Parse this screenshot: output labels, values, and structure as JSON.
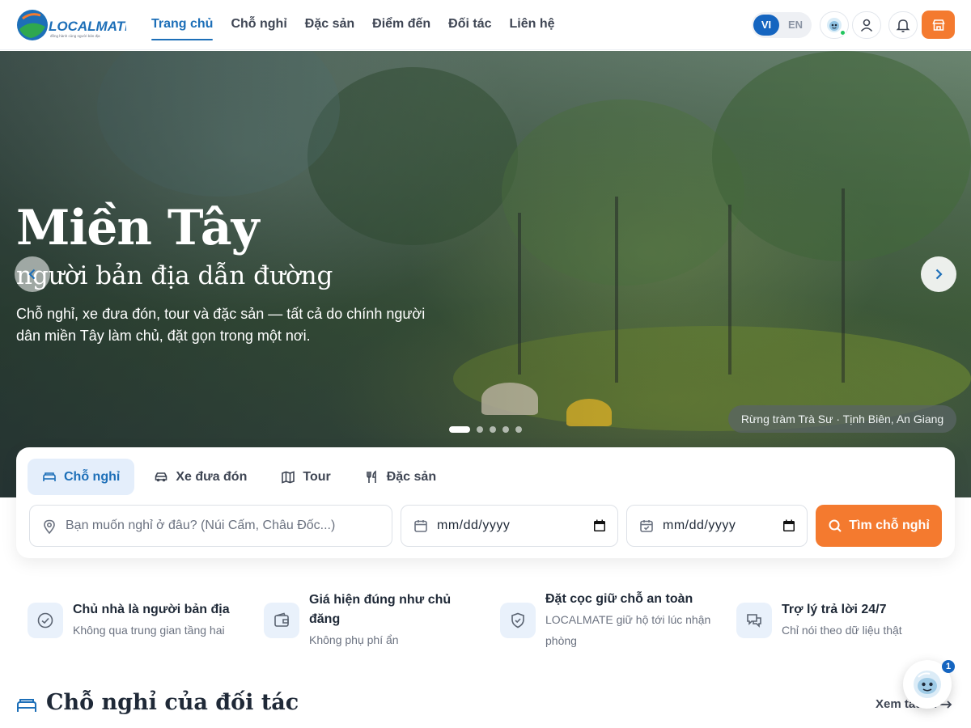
{
  "brand": {
    "name": "LOCALMATE",
    "tagline": "đồng hành cùng người bản địa",
    "colors": {
      "primary": "#1d6fb8",
      "accent": "#f47a2f",
      "logo_green": "#2fa84f"
    }
  },
  "nav": {
    "items": [
      {
        "label": "Trang chủ",
        "active": true
      },
      {
        "label": "Chỗ nghỉ",
        "active": false
      },
      {
        "label": "Đặc sản",
        "active": false
      },
      {
        "label": "Điểm đến",
        "active": false
      },
      {
        "label": "Đối tác",
        "active": false
      },
      {
        "label": "Liên hệ",
        "active": false
      }
    ]
  },
  "header": {
    "lang_vi": "VI",
    "lang_en": "EN",
    "selected_lang": "VI",
    "icons": [
      "assistant-icon",
      "user-icon",
      "bell-icon",
      "shop-icon"
    ]
  },
  "hero": {
    "title": "Miền Tây",
    "subtitle": "người bản địa dẫn đường",
    "description": "Chỗ nghỉ, xe đưa đón, tour và đặc sản — tất cả do chính người dân miền Tây làm chủ, đặt gọn trong một nơi.",
    "caption": "Rừng tràm Trà Sư · Tịnh Biên, An Giang",
    "slides_total": 5,
    "slide_active": 1
  },
  "search": {
    "tabs": [
      {
        "label": "Chỗ nghỉ",
        "icon": "bed-icon",
        "active": true
      },
      {
        "label": "Xe đưa đón",
        "icon": "car-icon",
        "active": false
      },
      {
        "label": "Tour",
        "icon": "map-icon",
        "active": false
      },
      {
        "label": "Đặc sản",
        "icon": "utensils-icon",
        "active": false
      }
    ],
    "where_placeholder": "Bạn muốn nghỉ ở đâu? (Núi Cấm, Châu Đốc...)",
    "checkin_value": "mm/dd/yyyy",
    "checkout_value": "mm/dd/yyyy",
    "button_label": "Tìm chỗ nghỉ"
  },
  "features": [
    {
      "title": "Chủ nhà là người bản địa",
      "subtitle": "Không qua trung gian tầng hai",
      "icon": "check-circle-icon"
    },
    {
      "title": "Giá hiện đúng như chủ đăng",
      "subtitle": "Không phụ phí ẩn",
      "icon": "wallet-icon"
    },
    {
      "title": "Đặt cọc giữ chỗ an toàn",
      "subtitle": "LOCALMATE giữ hộ tới lúc nhận phòng",
      "icon": "shield-icon"
    },
    {
      "title": "Trợ lý trả lời 24/7",
      "subtitle": "Chỉ nói theo dữ liệu thật",
      "icon": "chat-icon"
    }
  ],
  "section": {
    "title": "Chỗ nghỉ của đối tác",
    "see_all": "Xem tất cả"
  },
  "chat_widget": {
    "badge": "1"
  }
}
